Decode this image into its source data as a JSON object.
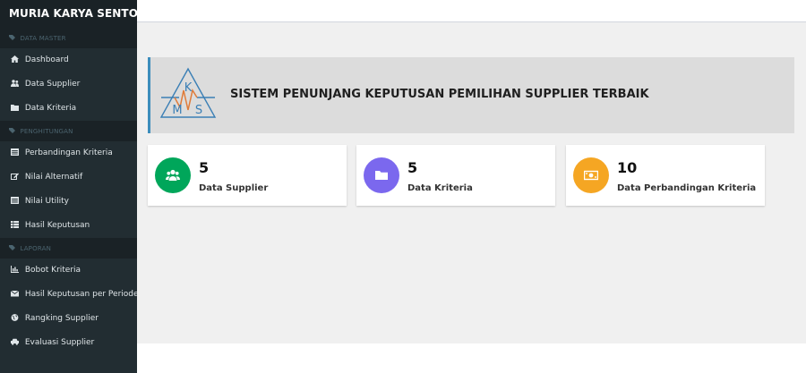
{
  "brand": "MURIA KARYA SENTOSA",
  "sidebar": {
    "sections": [
      {
        "label": "DATA MASTER",
        "items": [
          {
            "label": "Dashboard",
            "icon": "home-icon"
          },
          {
            "label": "Data Supplier",
            "icon": "users-icon"
          },
          {
            "label": "Data Kriteria",
            "icon": "folder-icon"
          }
        ]
      },
      {
        "label": "PENGHITUNGAN",
        "items": [
          {
            "label": "Perbandingan Kriteria",
            "icon": "list-icon"
          },
          {
            "label": "Nilai Alternatif",
            "icon": "edit-icon"
          },
          {
            "label": "Nilai Utility",
            "icon": "list-icon"
          },
          {
            "label": "Hasil Keputusan",
            "icon": "table-icon"
          }
        ]
      },
      {
        "label": "LAPORAN",
        "items": [
          {
            "label": "Bobot Kriteria",
            "icon": "bar-chart-icon"
          },
          {
            "label": "Hasil Keputusan per Periode",
            "icon": "envelope-icon"
          },
          {
            "label": "Rangking Supplier",
            "icon": "globe-icon"
          },
          {
            "label": "Evaluasi Supplier",
            "icon": "car-icon"
          }
        ]
      }
    ]
  },
  "hero": {
    "title": "SISTEM PENUNJANG KEPUTUSAN PEMILIHAN SUPPLIER TERBAIK",
    "logo_letters": {
      "top": "K",
      "left": "M",
      "right": "S"
    }
  },
  "cards": [
    {
      "value": "5",
      "label": "Data Supplier",
      "color": "#00a65a",
      "icon": "users-icon"
    },
    {
      "value": "5",
      "label": "Data Kriteria",
      "color": "#7b68ee",
      "icon": "folder-icon"
    },
    {
      "value": "10",
      "label": "Data Perbandingan Kriteria",
      "color": "#f5a623",
      "icon": "money-icon"
    }
  ],
  "colors": {
    "sidebar": "#222d32",
    "accent": "#3c8dbc"
  }
}
